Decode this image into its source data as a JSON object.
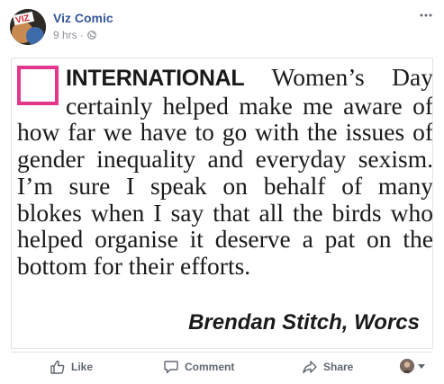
{
  "post": {
    "author": "Viz Comic",
    "timestamp": "9 hrs",
    "separator": "·",
    "privacy_icon": "globe-icon",
    "more_icon": "more-options-icon"
  },
  "letter": {
    "lead": "INTERNATIONAL",
    "body": " Women’s Day certainly helped make me aware of how far we have to go with the issues of gender inequality and everyday sexism. I’m sure I speak on behalf of many blokes when I say that all the birds who helped organise it deserve a pat on the bottom for their efforts.",
    "signature": "Brendan Stitch, Worcs",
    "accent_color": "#e2378c"
  },
  "actions": {
    "like_label": "Like",
    "comment_label": "Comment",
    "share_label": "Share"
  },
  "colors": {
    "link_blue": "#365899",
    "meta_gray": "#90949c",
    "action_gray": "#606770"
  }
}
